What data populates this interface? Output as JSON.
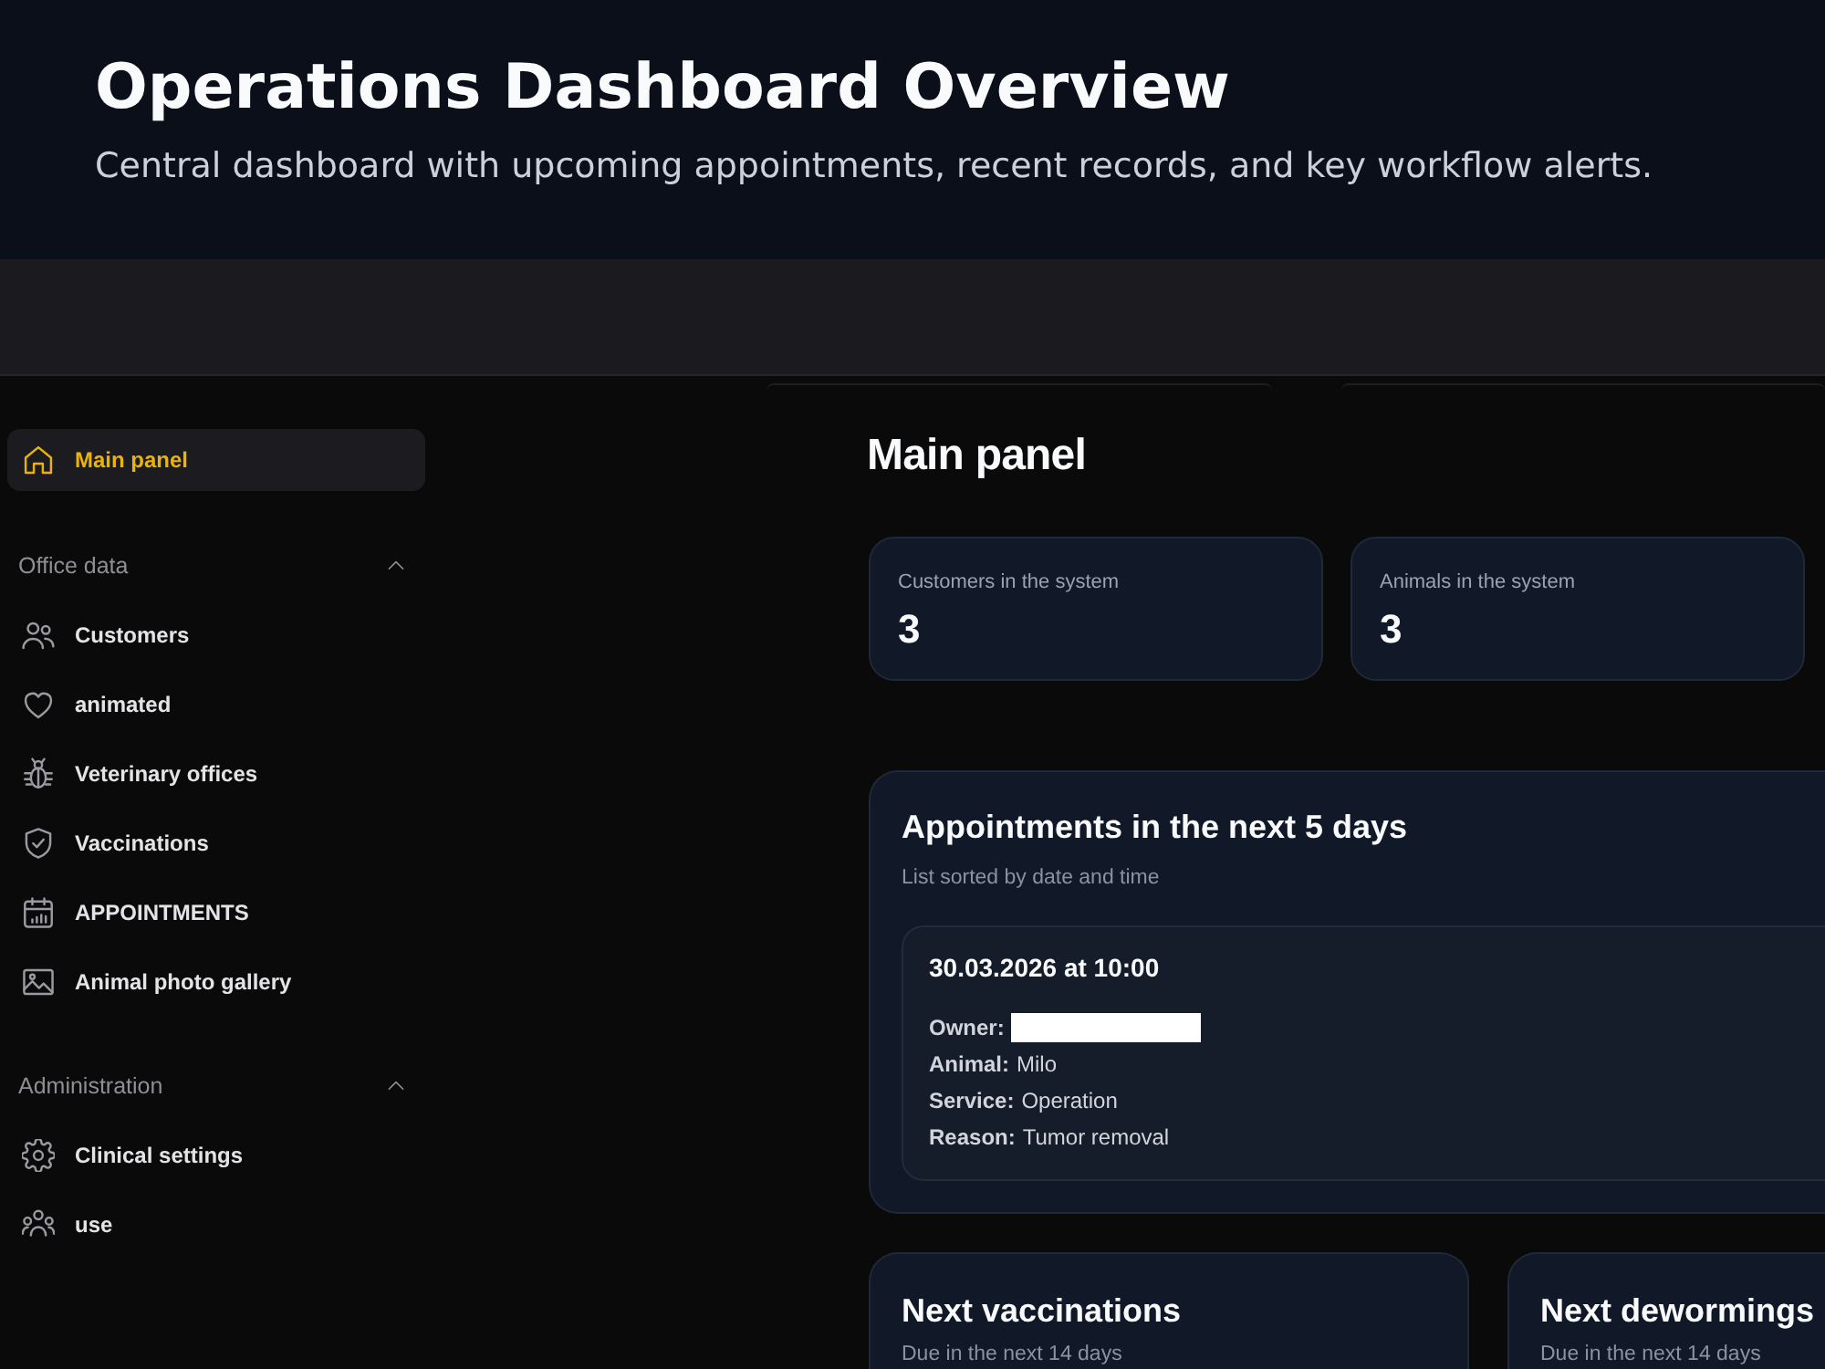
{
  "header": {
    "title": "Operations Dashboard Overview",
    "subtitle": "Central dashboard with upcoming appointments, recent records, and key workflow alerts."
  },
  "sidebar": {
    "items": [
      {
        "label": "Main panel",
        "selected": true
      }
    ],
    "sections": [
      {
        "title": "Office data",
        "expanded": true,
        "items": [
          {
            "label": "Customers",
            "selected": false
          },
          {
            "label": "animated",
            "selected": false
          },
          {
            "label": "Veterinary offices",
            "selected": false
          },
          {
            "label": "Vaccinations",
            "selected": false
          },
          {
            "label": "APPOINTMENTS",
            "selected": false
          },
          {
            "label": "Animal photo gallery",
            "selected": false
          }
        ]
      },
      {
        "title": "Administration",
        "expanded": true,
        "items": [
          {
            "label": "Clinical settings",
            "selected": false
          },
          {
            "label": "use",
            "selected": false
          }
        ]
      }
    ]
  },
  "main": {
    "title": "Main panel",
    "stats": [
      {
        "label": "Customers in the system",
        "value": "3"
      },
      {
        "label": "Animals in the system",
        "value": "3"
      }
    ],
    "appointments": {
      "title": "Appointments in the next 5 days",
      "subtitle": "List sorted by date and time",
      "items": [
        {
          "datetime": "30.03.2026 at 10:00",
          "fields": [
            {
              "label": "Owner:",
              "redacted": true
            },
            {
              "label": "Animal:",
              "value": "Milo",
              "redacted": false
            },
            {
              "label": "Service:",
              "value": "Operation",
              "redacted": false
            },
            {
              "label": "Reason:",
              "value": "Tumor removal",
              "redacted": false
            }
          ]
        }
      ]
    },
    "panels": [
      {
        "title": "Next vaccinations",
        "subtitle": "Due in the next 14 days"
      },
      {
        "title": "Next dewormings",
        "subtitle": "Due in the next 14 days"
      }
    ]
  }
}
